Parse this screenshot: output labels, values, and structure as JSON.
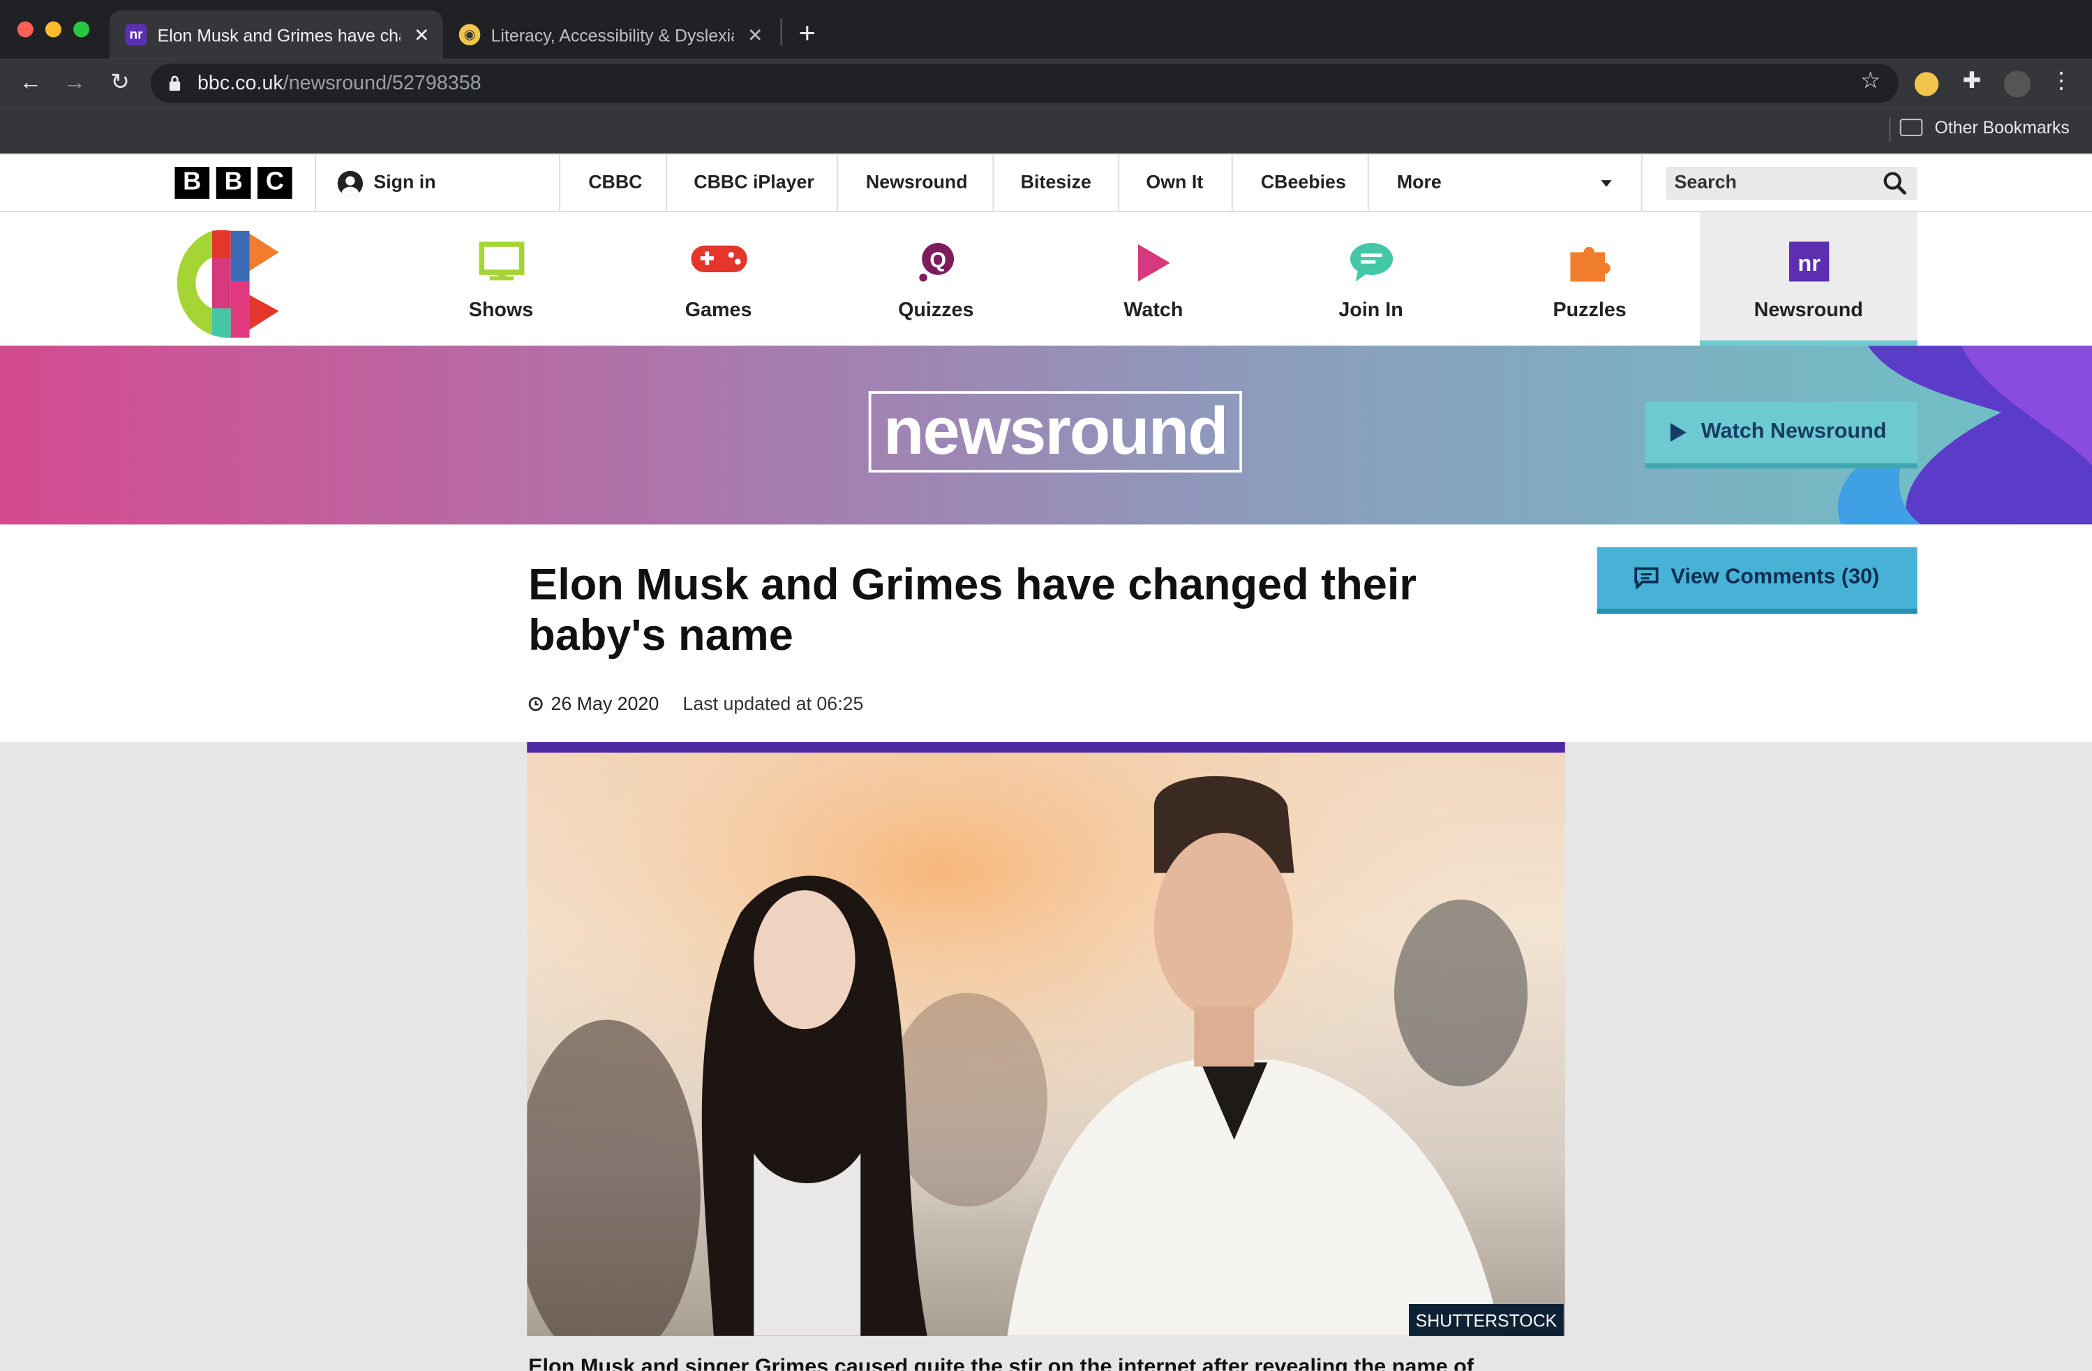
{
  "browser": {
    "tabs": [
      {
        "title": "Elon Musk and Grimes have changed their baby's name",
        "favicon_text": "nr",
        "active": true
      },
      {
        "title": "Literacy, Accessibility & Dyslexia",
        "active": false
      }
    ],
    "url_domain": "bbc.co.uk",
    "url_path": "/newsround/52798358",
    "bookmarks_label": "Other Bookmarks"
  },
  "bbc_bar": {
    "logo_letters": [
      "B",
      "B",
      "C"
    ],
    "sign_in": "Sign in",
    "links": [
      "CBBC",
      "CBBC iPlayer",
      "Newsround",
      "Bitesize",
      "Own It",
      "CBeebies"
    ],
    "more": "More",
    "search_placeholder": "Search"
  },
  "cbbc_nav": {
    "items": [
      {
        "label": "Shows",
        "icon": "tv-icon",
        "color": "#a5d535"
      },
      {
        "label": "Games",
        "icon": "gamepad-icon",
        "color": "#e3372b"
      },
      {
        "label": "Quizzes",
        "icon": "quiz-icon",
        "color": "#7d1c5c"
      },
      {
        "label": "Watch",
        "icon": "play-icon",
        "color": "#d6397e"
      },
      {
        "label": "Join In",
        "icon": "chat-icon",
        "color": "#43c7a7"
      },
      {
        "label": "Puzzles",
        "icon": "puzzle-icon",
        "color": "#f07d2b"
      },
      {
        "label": "Newsround",
        "icon": "newsround-icon",
        "color": "#5b2fb0",
        "active": true
      }
    ]
  },
  "hero": {
    "logo_text": "newsround",
    "watch_button": "Watch Newsround"
  },
  "article": {
    "headline": "Elon Musk and Grimes have changed their baby's name",
    "comments_button": "View Comments (30)",
    "date": "26 May 2020",
    "updated": "Last updated at 06:25",
    "image_credit": "SHUTTERSTOCK",
    "caption_start": "Elon Musk and singer Grimes caused quite the stir on the internet after revealing the name of"
  },
  "colors": {
    "accent_purple": "#4e2aa0",
    "hero_pink": "#d54a8f",
    "hero_teal": "#6cc4c6",
    "watch_button": "#6dcad1",
    "comments_button": "#47b2d6"
  }
}
